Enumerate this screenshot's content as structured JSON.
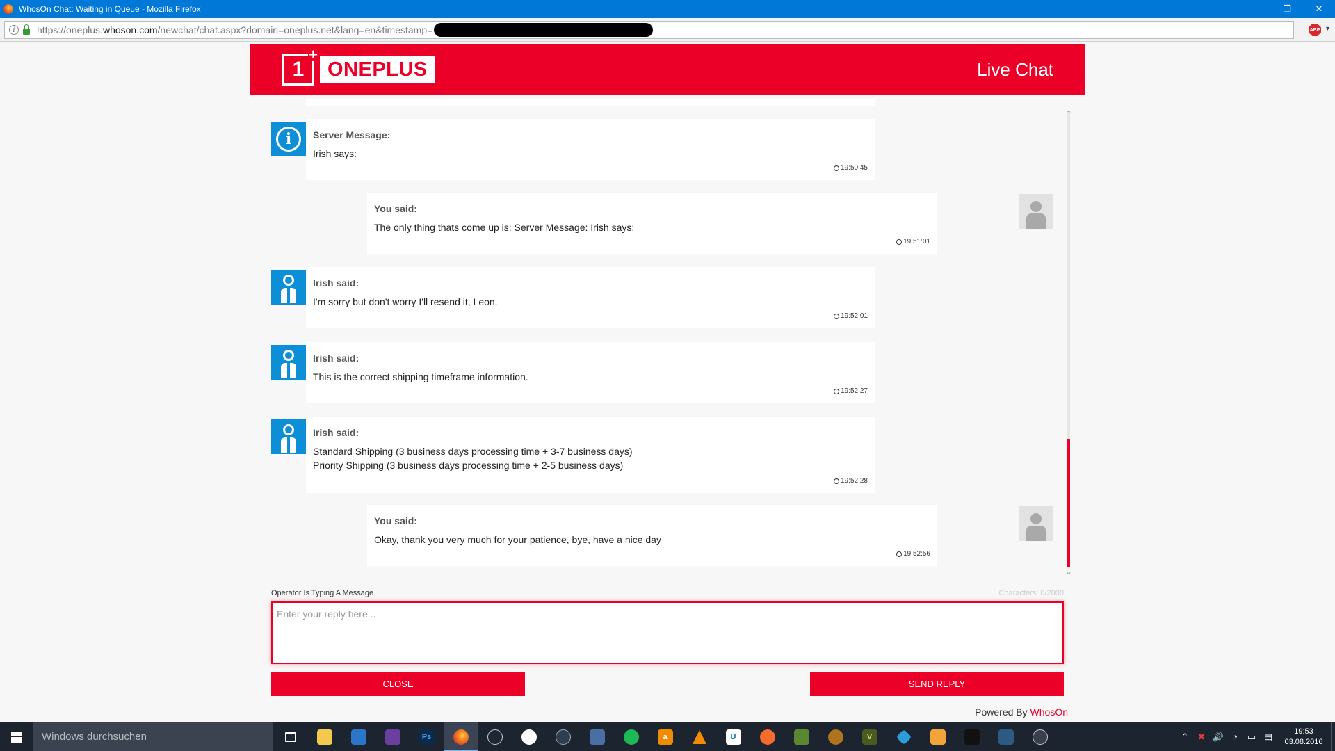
{
  "window": {
    "title": "WhosOn Chat: Waiting in Queue - Mozilla Firefox",
    "minimize_glyph": "—",
    "restore_glyph": "❐",
    "close_glyph": "✕"
  },
  "address": {
    "prefix": "https://oneplus.",
    "host": "whoson.com",
    "path": "/newchat/chat.aspx?domain=oneplus.net&lang=en&timestamp=",
    "addon_label": "ABP",
    "addon_caret": "▾"
  },
  "header": {
    "logo_mark": "1",
    "logo_plus": "+",
    "logo_text": "ONEPLUS",
    "live_chat": "Live Chat"
  },
  "messages": [
    {
      "type": "server",
      "label": "Server Message:",
      "lines": [
        "Irish says:"
      ],
      "time": "19:50:45"
    },
    {
      "type": "user",
      "label": "You said:",
      "lines": [
        "The only thing thats come up is: Server Message: Irish says:"
      ],
      "time": "19:51:01"
    },
    {
      "type": "agent",
      "label": "Irish said:",
      "lines": [
        "I'm sorry but don't worry I'll resend it, Leon."
      ],
      "time": "19:52:01"
    },
    {
      "type": "agent",
      "label": "Irish said:",
      "lines": [
        "This is the correct shipping timeframe information."
      ],
      "time": "19:52:27"
    },
    {
      "type": "agent",
      "label": "Irish said:",
      "lines": [
        "Standard Shipping (3 business days processing time + 3-7 business days)",
        "Priority Shipping (3 business days processing time + 2-5 business days)"
      ],
      "time": "19:52:28"
    },
    {
      "type": "user",
      "label": "You said:",
      "lines": [
        "Okay, thank you very much for your patience, bye, have a nice day"
      ],
      "time": "19:52:56"
    }
  ],
  "composer": {
    "typing_status": "Operator Is Typing A Message",
    "char_count": "Characters: 0/2000",
    "placeholder": "Enter your reply here...",
    "close_label": "CLOSE",
    "send_label": "SEND REPLY"
  },
  "footer": {
    "powered_prefix": "Powered By ",
    "powered_brand": "WhosOn"
  },
  "taskbar": {
    "search_placeholder": "Windows durchsuchen",
    "time": "19:53",
    "date": "03.08.2016",
    "tray_chevron": "⌃"
  },
  "colors": {
    "brand": "#eb0028",
    "agent_avatar": "#0c8fd6",
    "titlebar": "#0078d7",
    "taskbar": "#1c2430"
  }
}
